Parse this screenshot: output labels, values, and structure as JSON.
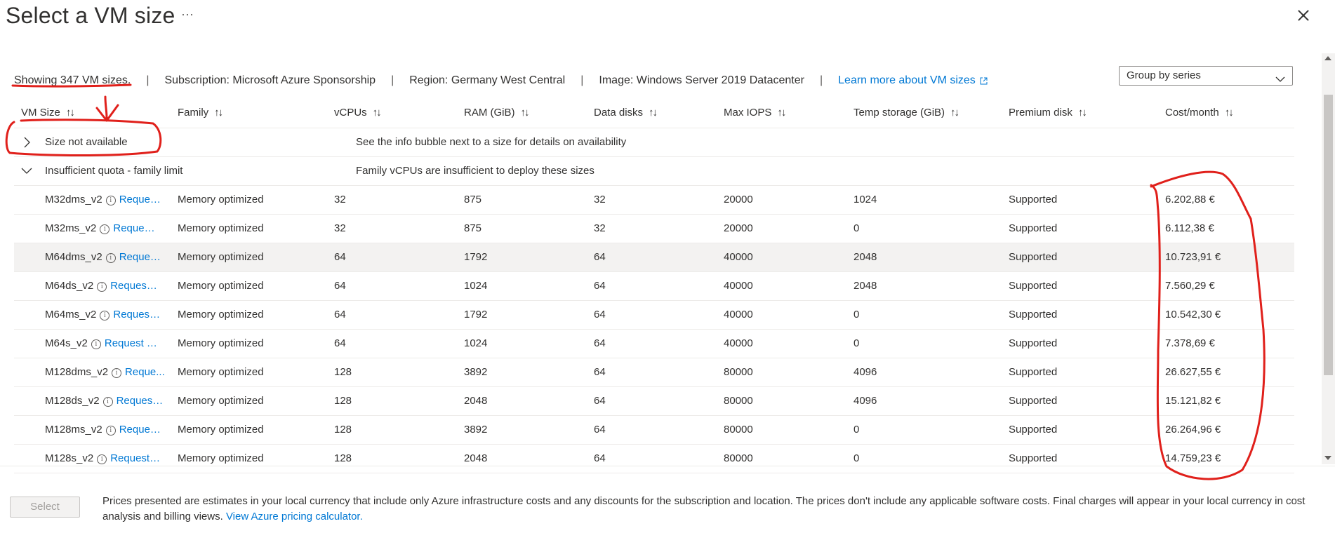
{
  "page": {
    "title": "Select a VM size",
    "more_icon": "ellipsis-icon",
    "close_icon": "close-icon"
  },
  "info": {
    "showing": "Showing 347 VM sizes.",
    "subscription": "Subscription: Microsoft Azure Sponsorship",
    "region": "Region: Germany West Central",
    "image": "Image: Windows Server 2019 Datacenter",
    "learn_more": "Learn more about VM sizes",
    "separator": "|"
  },
  "group_by": {
    "value": "Group by series"
  },
  "columns": [
    {
      "label": "VM Size"
    },
    {
      "label": "Family"
    },
    {
      "label": "vCPUs"
    },
    {
      "label": "RAM (GiB)"
    },
    {
      "label": "Data disks"
    },
    {
      "label": "Max IOPS"
    },
    {
      "label": "Temp storage (GiB)"
    },
    {
      "label": "Premium disk"
    },
    {
      "label": "Cost/month"
    }
  ],
  "sort_glyph": "↑↓",
  "groups": [
    {
      "name": "Size not available",
      "message": "See the info bubble next to a size for details on availability",
      "expanded": false
    },
    {
      "name": "Insufficient quota - family limit",
      "message": "Family vCPUs are insufficient to deploy these sizes",
      "expanded": true
    }
  ],
  "rows": [
    {
      "name": "M32dms_v2",
      "request": "Reques...",
      "family": "Memory optimized",
      "vcpus": "32",
      "ram": "875",
      "data_disks": "32",
      "max_iops": "20000",
      "temp_storage": "1024",
      "premium": "Supported",
      "cost": "6.202,88 €"
    },
    {
      "name": "M32ms_v2",
      "request": "Request ...",
      "family": "Memory optimized",
      "vcpus": "32",
      "ram": "875",
      "data_disks": "32",
      "max_iops": "20000",
      "temp_storage": "0",
      "premium": "Supported",
      "cost": "6.112,38 €"
    },
    {
      "name": "M64dms_v2",
      "request": "Reques...",
      "family": "Memory optimized",
      "vcpus": "64",
      "ram": "1792",
      "data_disks": "64",
      "max_iops": "40000",
      "temp_storage": "2048",
      "premium": "Supported",
      "cost": "10.723,91 €"
    },
    {
      "name": "M64ds_v2",
      "request": "Request ...",
      "family": "Memory optimized",
      "vcpus": "64",
      "ram": "1024",
      "data_disks": "64",
      "max_iops": "40000",
      "temp_storage": "2048",
      "premium": "Supported",
      "cost": "7.560,29 €"
    },
    {
      "name": "M64ms_v2",
      "request": "Request ...",
      "family": "Memory optimized",
      "vcpus": "64",
      "ram": "1792",
      "data_disks": "64",
      "max_iops": "40000",
      "temp_storage": "0",
      "premium": "Supported",
      "cost": "10.542,30 €"
    },
    {
      "name": "M64s_v2",
      "request": "Request q...",
      "family": "Memory optimized",
      "vcpus": "64",
      "ram": "1024",
      "data_disks": "64",
      "max_iops": "40000",
      "temp_storage": "0",
      "premium": "Supported",
      "cost": "7.378,69 €"
    },
    {
      "name": "M128dms_v2",
      "request": "Reque...",
      "family": "Memory optimized",
      "vcpus": "128",
      "ram": "3892",
      "data_disks": "64",
      "max_iops": "80000",
      "temp_storage": "4096",
      "premium": "Supported",
      "cost": "26.627,55 €"
    },
    {
      "name": "M128ds_v2",
      "request": "Request ...",
      "family": "Memory optimized",
      "vcpus": "128",
      "ram": "2048",
      "data_disks": "64",
      "max_iops": "80000",
      "temp_storage": "4096",
      "premium": "Supported",
      "cost": "15.121,82 €"
    },
    {
      "name": "M128ms_v2",
      "request": "Request...",
      "family": "Memory optimized",
      "vcpus": "128",
      "ram": "3892",
      "data_disks": "64",
      "max_iops": "80000",
      "temp_storage": "0",
      "premium": "Supported",
      "cost": "26.264,96 €"
    },
    {
      "name": "M128s_v2",
      "request": "Request ...",
      "family": "Memory optimized",
      "vcpus": "128",
      "ram": "2048",
      "data_disks": "64",
      "max_iops": "80000",
      "temp_storage": "0",
      "premium": "Supported",
      "cost": "14.759,23 €"
    }
  ],
  "footer": {
    "select_label": "Select",
    "note": "Prices presented are estimates in your local currency that include only Azure infrastructure costs and any discounts for the subscription and location. The prices don't include any applicable software costs. Final charges will appear in your local currency in cost analysis and billing views.",
    "pricing_link": "View Azure pricing calculator."
  },
  "colors": {
    "accent": "#0078d4",
    "annotation": "#e0201b",
    "row_highlight": "#f3f2f1"
  }
}
